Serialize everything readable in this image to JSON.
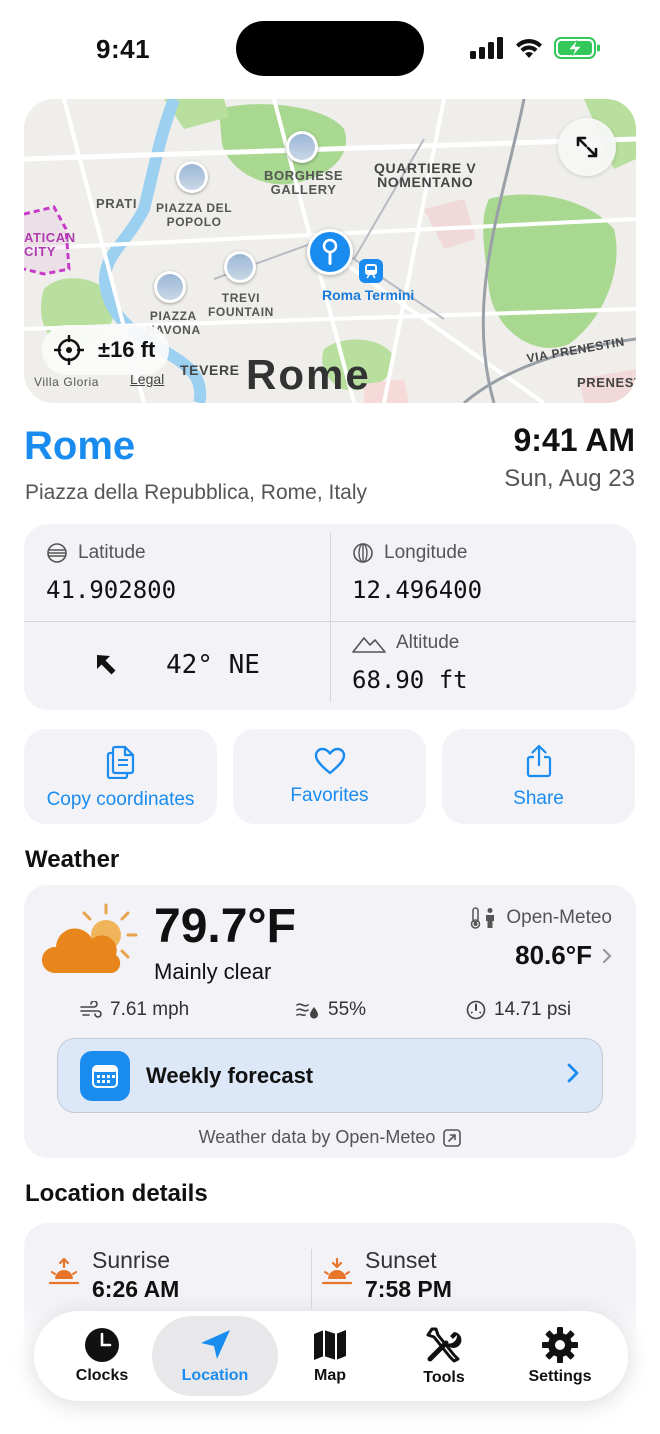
{
  "status_bar": {
    "time": "9:41"
  },
  "map": {
    "labels": {
      "prati": "PRATI",
      "borghese": "BORGHESE\nGALLERY",
      "quartiere": "QUARTIERE V\nNOMENTANO",
      "vatican": "ATICAN\nCITY",
      "piazza_popolo": "PIAZZA DEL\nPOPOLO",
      "trevi": "TREVI\nFOUNTAIN",
      "piazza_navona": "PIAZZA\nNAVONA",
      "tevere": "TEVERE",
      "via_prenestina": "VIA PRENESTIN",
      "prenest": "PRENEST",
      "villa": "Villa Gloria",
      "station": "Roma Termini",
      "city": "Rome",
      "legal": "Legal"
    },
    "accuracy": "±16 ft"
  },
  "location": {
    "city": "Rome",
    "address": "Piazza della Repubblica, Rome, Italy",
    "time": "9:41 AM",
    "date": "Sun, Aug 23"
  },
  "coordinates": {
    "latitude_label": "Latitude",
    "latitude_value": "41.902800",
    "longitude_label": "Longitude",
    "longitude_value": "12.496400",
    "heading_value": "42° NE",
    "altitude_label": "Altitude",
    "altitude_value": "68.90 ft"
  },
  "actions": {
    "copy": "Copy coordinates",
    "favorites": "Favorites",
    "share": "Share"
  },
  "weather": {
    "title": "Weather",
    "temperature": "79.7°F",
    "condition": "Mainly clear",
    "source": "Open-Meteo",
    "feels_like": "80.6°F",
    "wind": "7.61 mph",
    "humidity": "55%",
    "pressure": "14.71 psi",
    "forecast_label": "Weekly forecast",
    "attribution": "Weather data by Open-Meteo"
  },
  "details": {
    "title": "Location details",
    "sunrise_label": "Sunrise",
    "sunrise_time": "6:26 AM",
    "sunset_label": "Sunset",
    "sunset_time": "7:58 PM"
  },
  "tabs": [
    {
      "label": "Clocks"
    },
    {
      "label": "Location"
    },
    {
      "label": "Map"
    },
    {
      "label": "Tools"
    },
    {
      "label": "Settings"
    }
  ],
  "colors": {
    "accent": "#1a8cf0",
    "card": "#f2f2f7",
    "sun_orange": "#e8762a"
  }
}
